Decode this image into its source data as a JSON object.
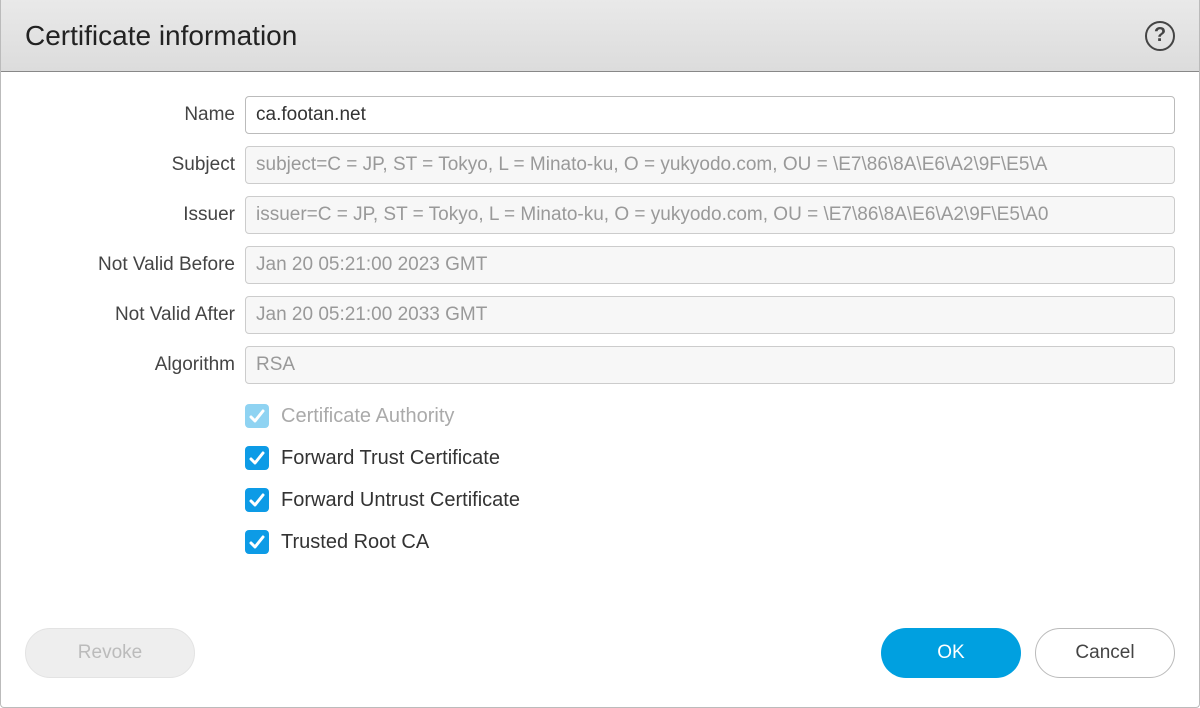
{
  "dialog": {
    "title": "Certificate information"
  },
  "form": {
    "name": {
      "label": "Name",
      "value": "ca.footan.net"
    },
    "subject": {
      "label": "Subject",
      "value": "subject=C = JP, ST = Tokyo, L = Minato-ku, O = yukyodo.com, OU = \\E7\\86\\8A\\E6\\A2\\9F\\E5\\A"
    },
    "issuer": {
      "label": "Issuer",
      "value": "issuer=C = JP, ST = Tokyo, L = Minato-ku, O = yukyodo.com, OU = \\E7\\86\\8A\\E6\\A2\\9F\\E5\\A0"
    },
    "not_valid_before": {
      "label": "Not Valid Before",
      "value": "Jan 20 05:21:00 2023 GMT"
    },
    "not_valid_after": {
      "label": "Not Valid After",
      "value": "Jan 20 05:21:00 2033 GMT"
    },
    "algorithm": {
      "label": "Algorithm",
      "value": "RSA"
    }
  },
  "checkboxes": {
    "ca": {
      "label": "Certificate Authority",
      "checked": true,
      "disabled": true
    },
    "fwd_trust": {
      "label": "Forward Trust Certificate",
      "checked": true,
      "disabled": false
    },
    "fwd_untrust": {
      "label": "Forward Untrust Certificate",
      "checked": true,
      "disabled": false
    },
    "trusted_root": {
      "label": "Trusted Root CA",
      "checked": true,
      "disabled": false
    }
  },
  "buttons": {
    "revoke": "Revoke",
    "ok": "OK",
    "cancel": "Cancel"
  },
  "help_glyph": "?"
}
